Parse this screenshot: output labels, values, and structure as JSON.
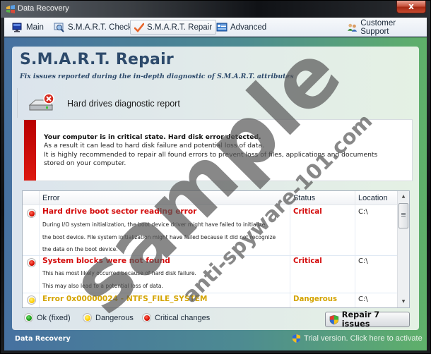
{
  "window": {
    "title": "Data Recovery",
    "close_label": "x"
  },
  "menu": {
    "items": [
      {
        "label": "Main",
        "icon": "monitor-icon"
      },
      {
        "label": "S.M.A.R.T. Check",
        "icon": "magnifier-icon"
      },
      {
        "label": "S.M.A.R.T. Repair",
        "icon": "checkmark-icon",
        "active": true
      },
      {
        "label": "Advanced",
        "icon": "settings-window-icon"
      }
    ],
    "support_label": "Customer Support"
  },
  "page": {
    "title": "S.M.A.R.T. Repair",
    "subtitle": "Fix issues reported during the in-depth diagnostic of S.M.A.R.T. attributes",
    "report_heading": "Hard drives diagnostic report"
  },
  "alert": {
    "headline": "Your computer is in critical state. Hard disk error detected.",
    "line1": "As a result it can lead to hard disk failure and potential loss of data.",
    "line2": "It is highly recommended to repair all found errors to prevent loss of files, applications and documents",
    "line3": "stored on your computer.",
    "accent_color": "#cc0a05"
  },
  "table": {
    "columns": [
      "Error",
      "Status",
      "Location"
    ],
    "rows": [
      {
        "severity": "red",
        "title": "Hard drive boot sector reading error",
        "description": [
          "During I/O system initialization, the boot device driver might have failed to initialize",
          "the boot device. File system initialization might have failed because it did not recognize",
          "the data on the boot device."
        ],
        "status": "Critical",
        "location": "C:\\"
      },
      {
        "severity": "red",
        "title": "System blocks were not found",
        "description": [
          "This has most likely occurred because of hard disk failure.",
          "This may also lead to a potential loss of data."
        ],
        "status": "Critical",
        "location": "C:\\"
      },
      {
        "severity": "yellow",
        "title": "Error 0x00000024 - NTFS_FILE_SYSTEM",
        "description": [],
        "status": "Dangerous",
        "location": "C:\\"
      }
    ]
  },
  "legend": {
    "ok": "Ok (fixed)",
    "dangerous": "Dangerous",
    "critical": "Critical changes"
  },
  "colors": {
    "critical": "#d40a0a",
    "dangerous": "#d4a400",
    "ok": "#1a9a18",
    "title_blue": "#2d4a6b"
  },
  "actions": {
    "repair_label": "Repair 7 issues"
  },
  "statusbar": {
    "app_name": "Data Recovery",
    "activation_text": "Trial version. Click here to activate"
  },
  "watermark": {
    "main": "sample",
    "sub": "anti-spyware-101.com"
  }
}
